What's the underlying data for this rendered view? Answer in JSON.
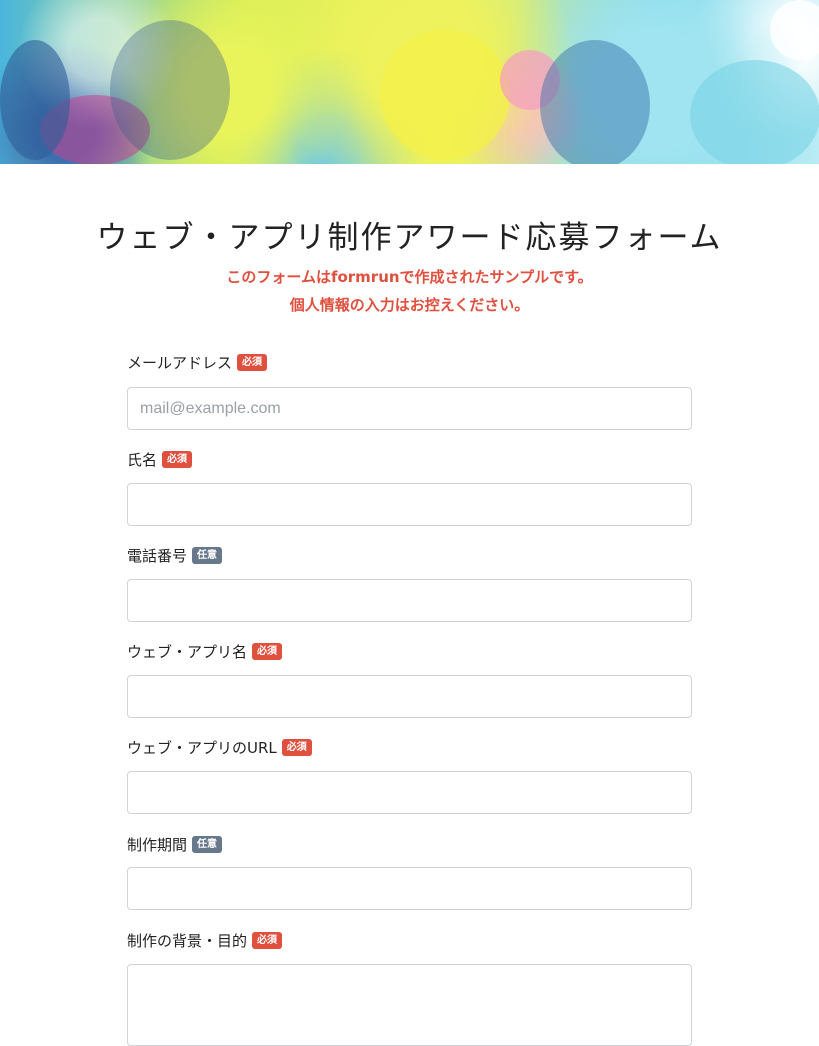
{
  "header": {
    "image": "festival-color-powder-banner"
  },
  "form": {
    "title": "ウェブ・アプリ制作アワード応募フォーム",
    "notice_line1": "このフォームはformrunで作成されたサンプルです。",
    "notice_line2": "個人情報の入力はお控えください。",
    "fields": [
      {
        "label": "メールアドレス",
        "badge": "必須",
        "required": true,
        "placeholder": "mail@example.com",
        "value": ""
      },
      {
        "label": "氏名",
        "badge": "必須",
        "required": true,
        "placeholder": "",
        "value": ""
      },
      {
        "label": "電話番号",
        "badge": "任意",
        "required": false,
        "placeholder": "",
        "value": ""
      },
      {
        "label": "ウェブ・アプリ名",
        "badge": "必須",
        "required": true,
        "placeholder": "",
        "value": ""
      },
      {
        "label": "ウェブ・アプリのURL",
        "badge": "必須",
        "required": true,
        "placeholder": "",
        "value": ""
      },
      {
        "label": "制作期間",
        "badge": "任意",
        "required": false,
        "placeholder": "",
        "value": ""
      },
      {
        "label": "制作の背景・目的",
        "badge": "必須",
        "required": true,
        "placeholder": "",
        "value": ""
      }
    ]
  },
  "colors": {
    "required_badge": "#e0503f",
    "optional_badge": "#66788a",
    "notice_text": "#e0503f"
  }
}
